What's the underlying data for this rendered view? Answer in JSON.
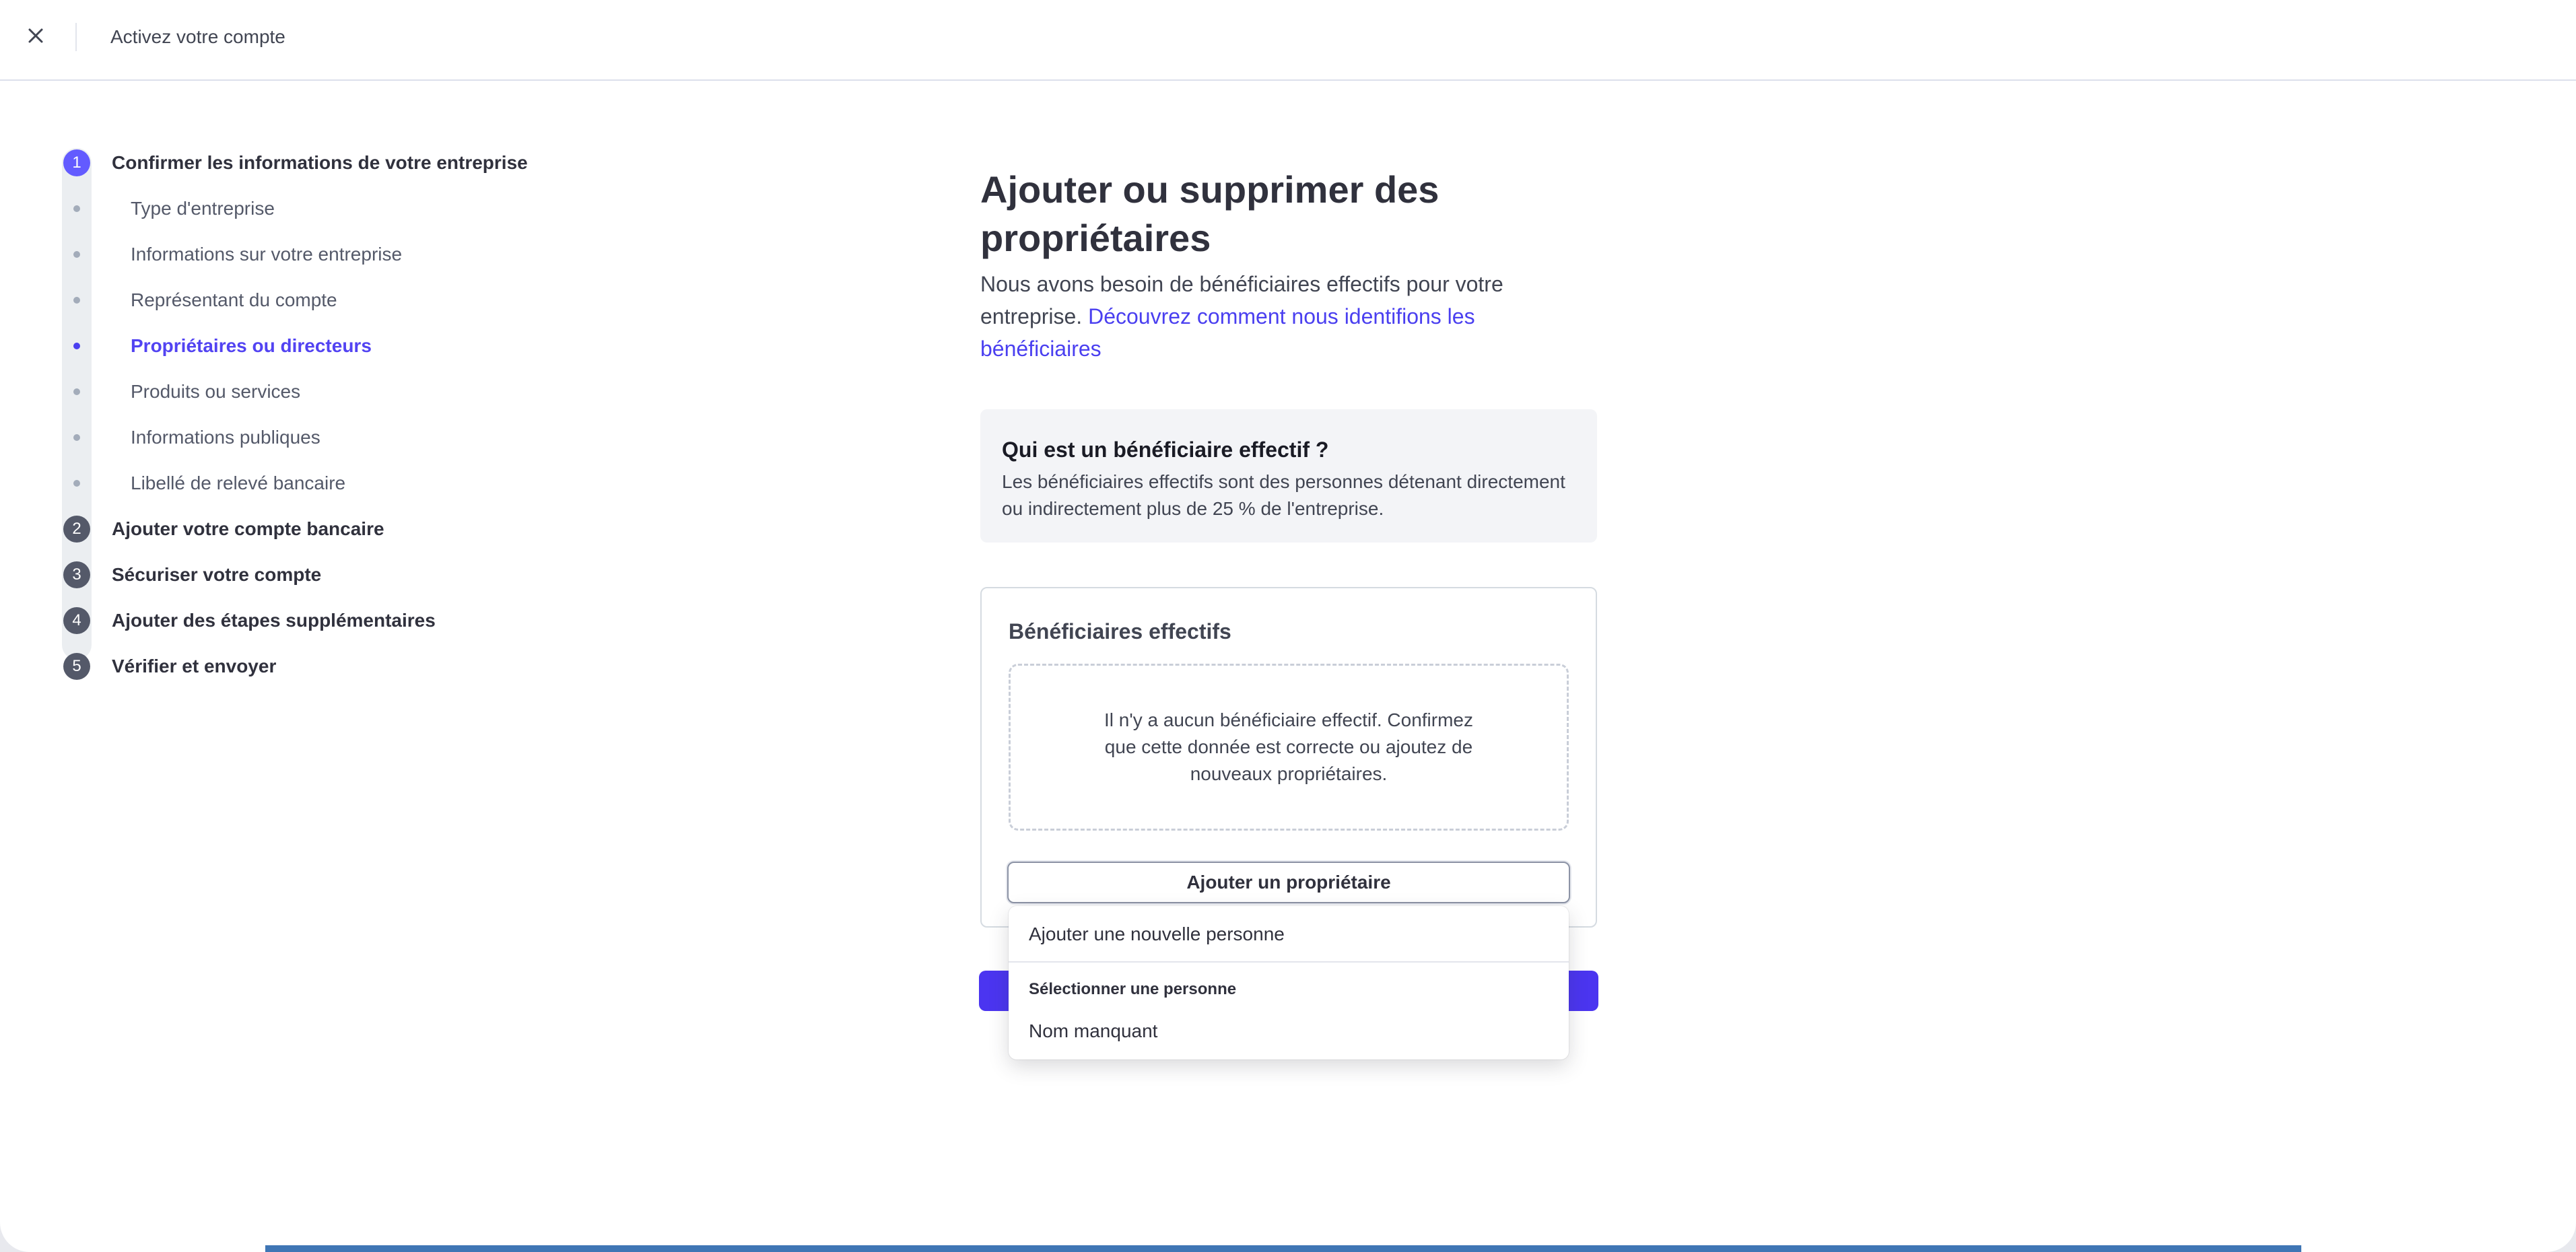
{
  "header": {
    "title": "Activez votre compte"
  },
  "stepper": {
    "steps": [
      {
        "number": "1",
        "label": "Confirmer les informations de votre entreprise"
      },
      {
        "number": "2",
        "label": "Ajouter votre compte bancaire"
      },
      {
        "number": "3",
        "label": "Sécuriser votre compte"
      },
      {
        "number": "4",
        "label": "Ajouter des étapes supplémentaires"
      },
      {
        "number": "5",
        "label": "Vérifier et envoyer"
      }
    ],
    "substeps": [
      "Type d'entreprise",
      "Informations sur votre entreprise",
      "Représentant du compte",
      "Propriétaires ou directeurs",
      "Produits ou services",
      "Informations publiques",
      "Libellé de relevé bancaire"
    ]
  },
  "main": {
    "title": "Ajouter ou supprimer des propriétaires",
    "intro_text": "Nous avons besoin de bénéficiaires effectifs pour votre entreprise. ",
    "intro_link": "Découvrez comment nous identifions les bénéficiaires",
    "info_box": {
      "title": "Qui est un bénéficiaire effectif ?",
      "text": "Les bénéficiaires effectifs sont des personnes détenant directement ou indirectement plus de 25 % de l'entreprise."
    },
    "owners_card": {
      "title": "Bénéficiaires effectifs",
      "empty_text": "Il n'y a aucun bénéficiaire effectif. Confirmez que cette donnée est correcte ou ajoutez de nouveaux propriétaires.",
      "add_button": "Ajouter un propriétaire"
    }
  },
  "dropdown": {
    "add_new": "Ajouter une nouvelle personne",
    "section_heading": "Sélectionner une personne",
    "options": [
      "Nom manquant"
    ]
  },
  "colors": {
    "accent": "#635bff",
    "link": "#4a3ff0",
    "primary_button": "#4b35f0"
  }
}
